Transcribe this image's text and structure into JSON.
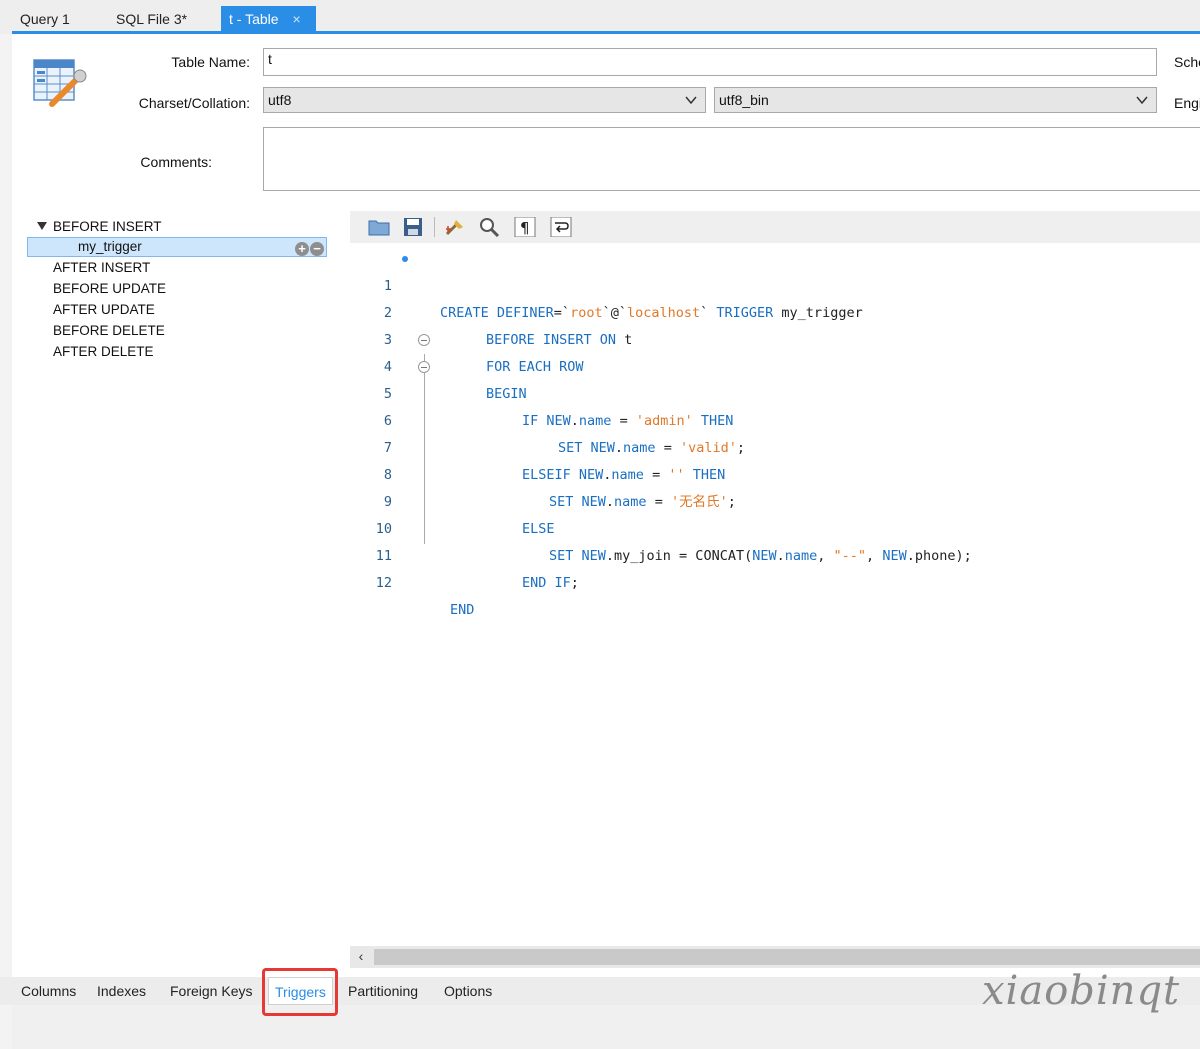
{
  "tabs": [
    {
      "label": "Query 1"
    },
    {
      "label": "SQL File 3*"
    },
    {
      "label": "t - Table",
      "close": "×"
    }
  ],
  "form": {
    "table_name_label": "Table Name:",
    "table_name_value": "t",
    "schema_label": "Schema:",
    "charset_label": "Charset/Collation:",
    "charset_value": "utf8",
    "collation_value": "utf8_bin",
    "engine_label": "Engine:",
    "comments_label": "Comments:"
  },
  "triggers": {
    "groups": [
      {
        "label": "BEFORE INSERT",
        "expanded": true,
        "children": [
          "my_trigger"
        ]
      },
      {
        "label": "AFTER INSERT"
      },
      {
        "label": "BEFORE UPDATE"
      },
      {
        "label": "AFTER UPDATE"
      },
      {
        "label": "BEFORE DELETE"
      },
      {
        "label": "AFTER DELETE"
      }
    ],
    "add_symbol": "+",
    "remove_symbol": "−"
  },
  "toolbar": {
    "icons": [
      "open-folder-icon",
      "save-icon",
      "beautify-icon",
      "find-icon",
      "invisible-chars-icon",
      "word-wrap-icon"
    ]
  },
  "code": {
    "line_numbers": [
      "1",
      "2",
      "3",
      "4",
      "5",
      "6",
      "7",
      "8",
      "9",
      "10",
      "11",
      "12"
    ]
  },
  "bottom_tabs": [
    "Columns",
    "Indexes",
    "Foreign Keys",
    "Triggers",
    "Partitioning",
    "Options"
  ],
  "active_bottom_tab": "Triggers",
  "watermark": "xiaobinqt",
  "colors": {
    "accent": "#2a8de6",
    "keyword": "#1a6fc2",
    "string": "#e0792a",
    "highlight": "#e53935"
  }
}
